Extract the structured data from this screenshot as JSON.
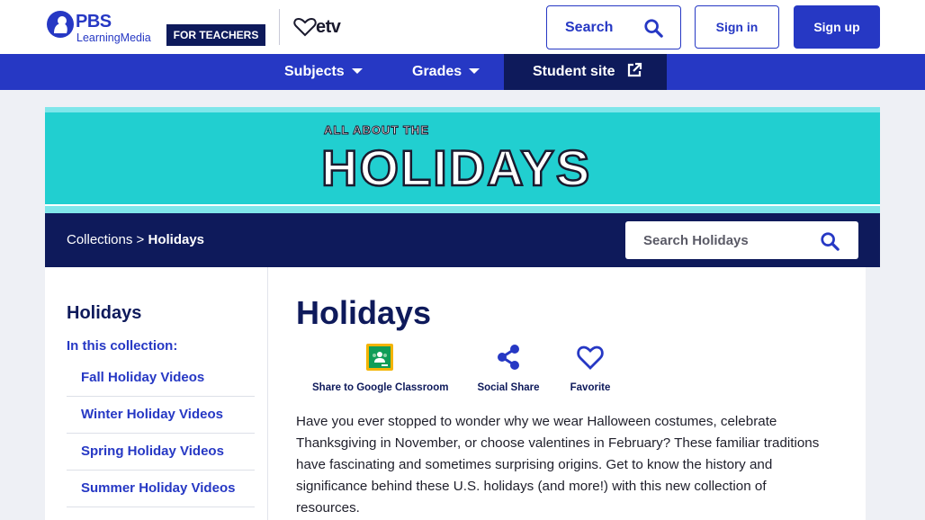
{
  "header": {
    "logo_top": "PBS",
    "logo_bottom": "LearningMedia",
    "teachers_badge": "FOR TEACHERS",
    "partner_logo": "etv",
    "search_label": "Search",
    "signin_label": "Sign in",
    "signup_label": "Sign up"
  },
  "nav": {
    "subjects": "Subjects",
    "grades": "Grades",
    "student_site": "Student site"
  },
  "banner": {
    "small_text": "ALL ABOUT THE",
    "title": "HOLIDAYS"
  },
  "breadcrumb": {
    "parent": "Collections",
    "separator": ">",
    "current": "Holidays"
  },
  "collection_search": {
    "placeholder": "Search Holidays"
  },
  "sidebar": {
    "title": "Holidays",
    "subtitle": "In this collection:",
    "items": [
      {
        "label": "Fall Holiday Videos"
      },
      {
        "label": "Winter Holiday Videos"
      },
      {
        "label": "Spring Holiday Videos"
      },
      {
        "label": "Summer Holiday Videos"
      }
    ]
  },
  "main": {
    "title": "Holidays",
    "actions": {
      "google": "Share to Google Classroom",
      "share": "Social Share",
      "favorite": "Favorite"
    },
    "description": "Have you ever stopped to wonder why we wear Halloween costumes, celebrate Thanksgiving in November, or choose valentines in February? These familiar traditions have fascinating and sometimes surprising origins. Get to know the history and significance behind these U.S. holidays (and more!) with this new collection of resources."
  },
  "colors": {
    "brand_blue": "#2638c4",
    "navy": "#0e1a5b",
    "banner_teal": "#21cfd0"
  },
  "icons": [
    "pbs-head-icon",
    "etv-heart-icon",
    "search-icon",
    "external-link-icon",
    "google-classroom-icon",
    "share-icon",
    "heart-icon"
  ]
}
